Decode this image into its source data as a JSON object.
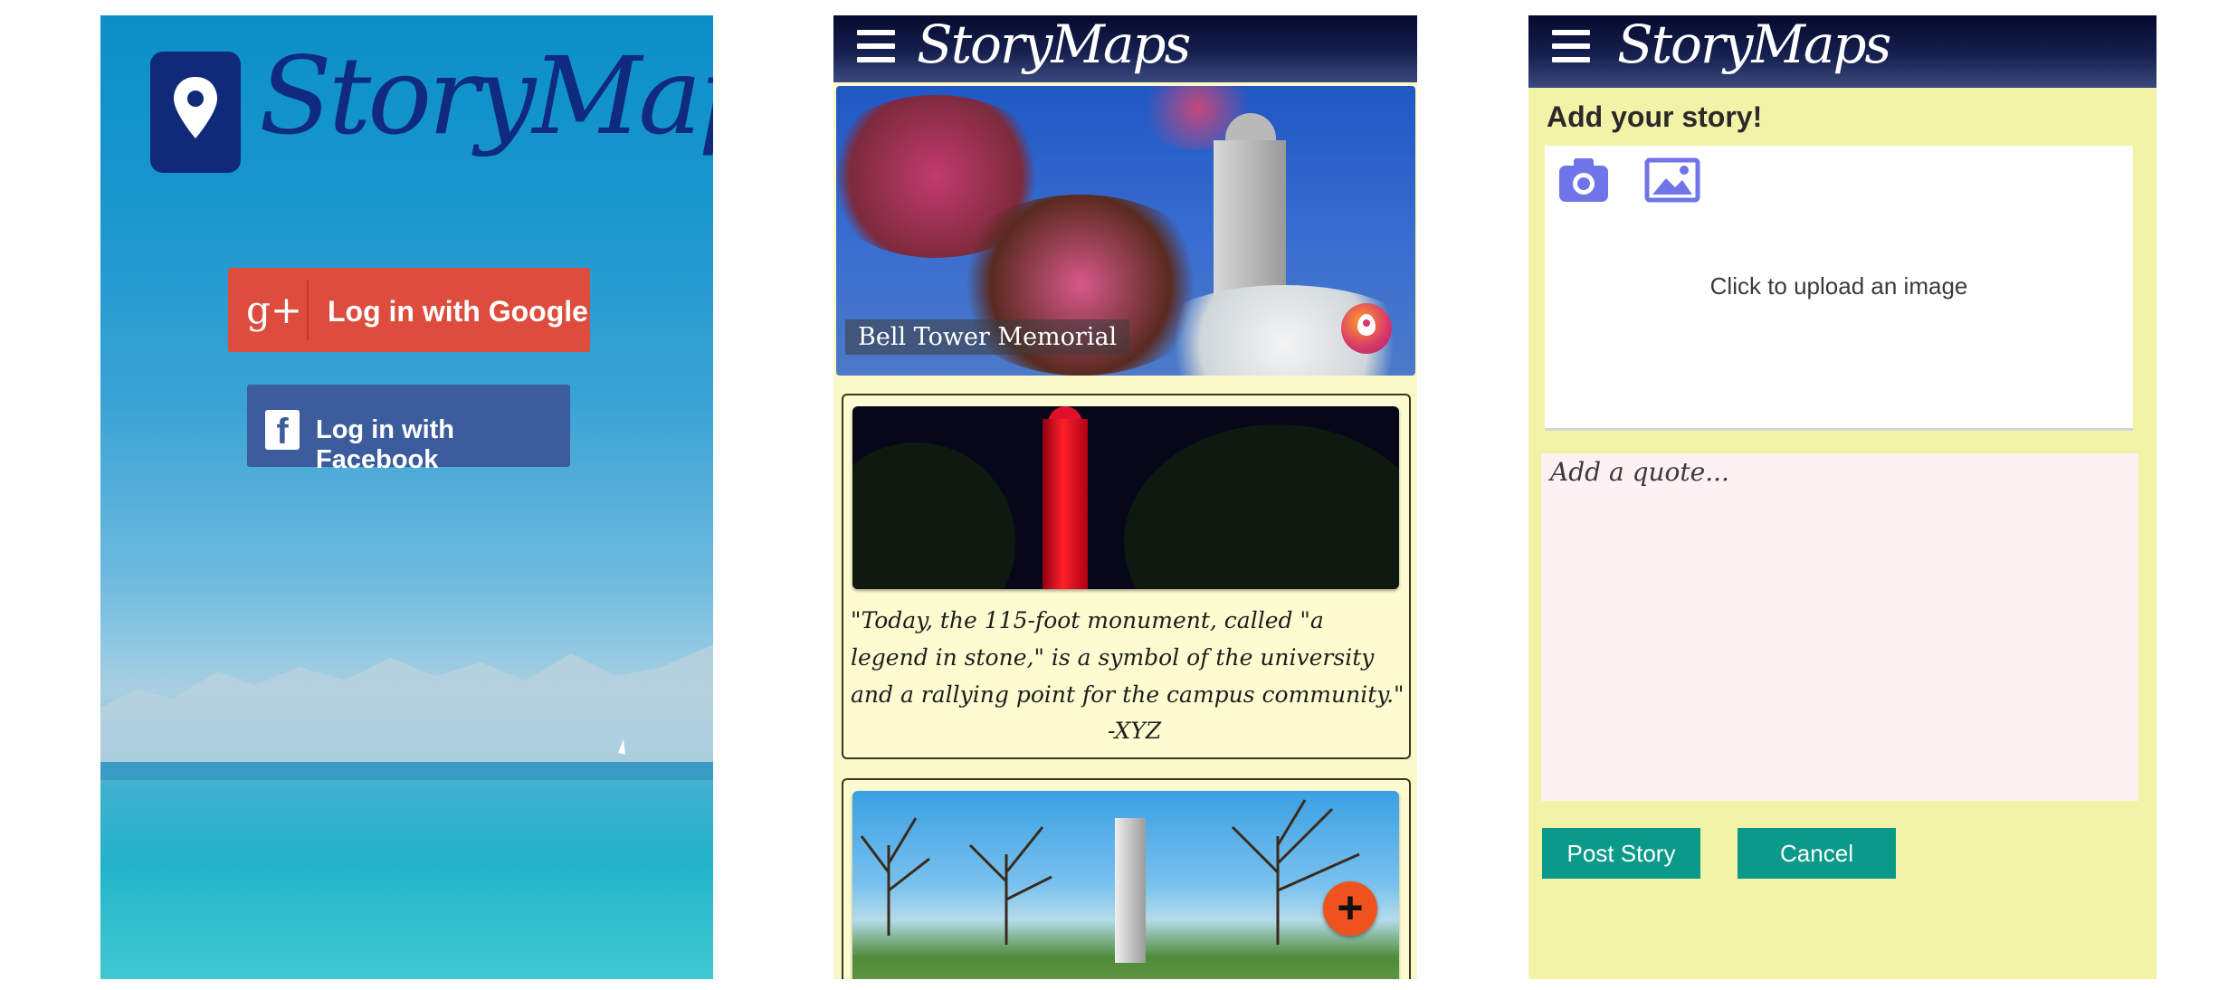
{
  "login": {
    "logo_text": "StoryMaps",
    "google_button": "Log in with Google",
    "google_icon": "g+",
    "facebook_button": "Log in with Facebook",
    "facebook_icon": "f"
  },
  "feed": {
    "header": {
      "brand": "StoryMaps",
      "menu_icon": "hamburger-icon"
    },
    "hero": {
      "title": "Bell Tower Memorial",
      "pin_icon": "map-pin-icon"
    },
    "story": {
      "quote": "\"Today, the 115-foot monument, called \"a legend in stone,\" is a symbol of the university and a rallying point for the campus community.\"",
      "author": "-XYZ"
    },
    "add_button": "+"
  },
  "add_story": {
    "header": {
      "brand": "StoryMaps",
      "menu_icon": "hamburger-icon"
    },
    "title": "Add your story!",
    "upload_text": "Click to upload an image",
    "quote_placeholder": "Add a quote...",
    "post_button": "Post Story",
    "cancel_button": "Cancel"
  },
  "colors": {
    "google_red": "#dd4c3d",
    "facebook_blue": "#3d5c9c",
    "header_navy": "#16204f",
    "yellow_bg": "#f2f3a7",
    "teal_button": "#0b9a89",
    "fab_orange": "#f0521d"
  }
}
